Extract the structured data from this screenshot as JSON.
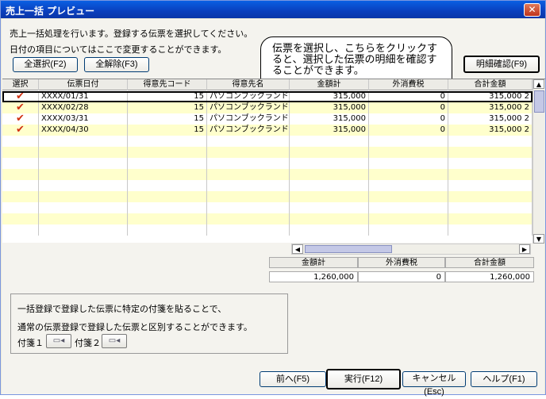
{
  "window": {
    "title": "売上一括 プレビュー",
    "close_glyph": "✕"
  },
  "instructions": {
    "line1": "売上一括処理を行います。登録する伝票を選択してください。",
    "line2": "日付の項目についてはここで変更することができます。"
  },
  "toolbar": {
    "select_all": "全選択(F2)",
    "deselect_all": "全解除(F3)",
    "detail_check": "明細確認(F9)"
  },
  "callout": {
    "text": "伝票を選択し、こちらをクリックすると、選択した伝票の明細を確認することができます。"
  },
  "grid": {
    "headers": [
      "選択",
      "伝票日付",
      "得意先コード",
      "得意先名",
      "金額計",
      "外消費税",
      "合計金額"
    ],
    "rows": [
      {
        "selected": "✔",
        "date": "XXXX/01/31",
        "code": "15",
        "name": "パソコンブックランド",
        "amount": "315,000",
        "tax": "0",
        "total": "315,000",
        "extra": "2"
      },
      {
        "selected": "✔",
        "date": "XXXX/02/28",
        "code": "15",
        "name": "パソコンブックランド",
        "amount": "315,000",
        "tax": "0",
        "total": "315,000",
        "extra": "2"
      },
      {
        "selected": "✔",
        "date": "XXXX/03/31",
        "code": "15",
        "name": "パソコンブックランド",
        "amount": "315,000",
        "tax": "0",
        "total": "315,000",
        "extra": "2"
      },
      {
        "selected": "✔",
        "date": "XXXX/04/30",
        "code": "15",
        "name": "パソコンブックランド",
        "amount": "315,000",
        "tax": "0",
        "total": "315,000",
        "extra": "2"
      }
    ]
  },
  "totals": {
    "headers": [
      "金額計",
      "外消費税",
      "合計金額"
    ],
    "values": [
      "1,260,000",
      "0",
      "1,260,000"
    ]
  },
  "tag_group": {
    "line1": "一括登録で登録した伝票に特定の付箋を貼ることで、",
    "line2": "通常の伝票登録で登録した伝票と区別することができます。",
    "tag1_label": "付箋１",
    "tag2_label": "付箋２"
  },
  "footer": {
    "prev": "前へ(F5)",
    "execute": "実行(F12)",
    "cancel": "キャンセル(Esc)",
    "help": "ヘルプ(F1)"
  },
  "colors": {
    "title_bar": "#0a3fbd",
    "row_highlight": "#ffffcc",
    "check_mark": "#d03010"
  }
}
